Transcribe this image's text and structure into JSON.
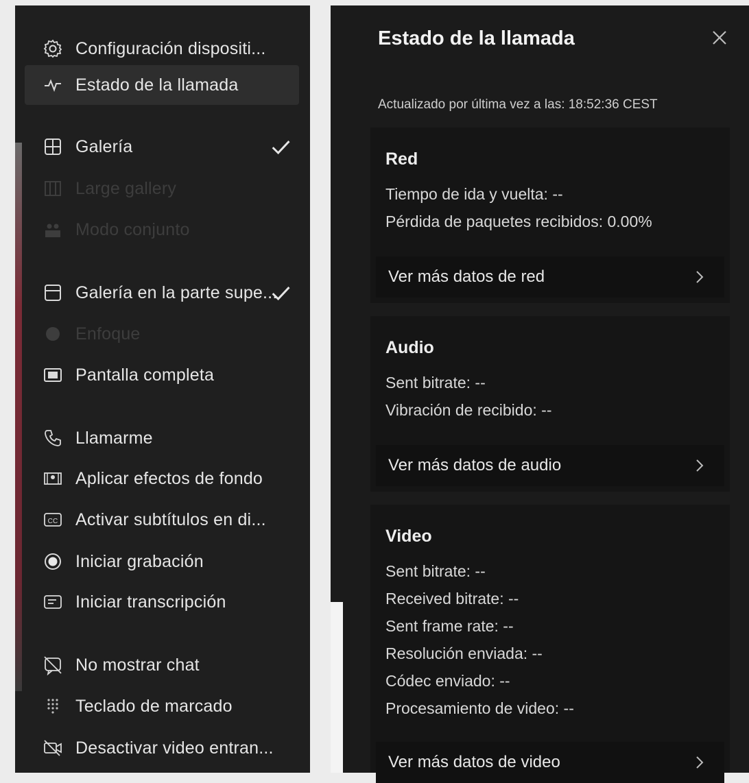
{
  "menu": {
    "items": [
      {
        "label": "Configuración dispositi...",
        "icon": "gear-icon"
      },
      {
        "label": "Estado de la llamada",
        "icon": "pulse-icon"
      },
      {
        "label": "Galería",
        "icon": "grid-icon"
      },
      {
        "label": "Large gallery",
        "icon": "large-grid-icon"
      },
      {
        "label": "Modo conjunto",
        "icon": "people-icon"
      },
      {
        "label": "Galería en la parte supe...",
        "icon": "layout-top-icon"
      },
      {
        "label": "Enfoque",
        "icon": "focus-icon"
      },
      {
        "label": "Pantalla completa",
        "icon": "fullscreen-icon"
      },
      {
        "label": "Llamarme",
        "icon": "phone-icon"
      },
      {
        "label": "Aplicar efectos de fondo",
        "icon": "background-effects-icon"
      },
      {
        "label": "Activar subtítulos en di...",
        "icon": "cc-icon"
      },
      {
        "label": "Iniciar grabación",
        "icon": "record-icon"
      },
      {
        "label": "Iniciar transcripción",
        "icon": "transcript-icon"
      },
      {
        "label": "No mostrar chat",
        "icon": "chat-off-icon"
      },
      {
        "label": "Teclado de marcado",
        "icon": "dialpad-icon"
      },
      {
        "label": "Desactivar video entran...",
        "icon": "video-off-icon"
      }
    ]
  },
  "status_panel": {
    "title": "Estado de la llamada",
    "updated": "Actualizado por última vez a las: 18:52:36 CEST",
    "red": {
      "title": "Red",
      "round_trip": "Tiempo de ida y vuelta: --",
      "packet_loss": "Pérdida de paquetes recibidos: 0.00%",
      "more": "Ver más datos de red"
    },
    "audio": {
      "title": "Audio",
      "sent_bitrate": "Sent bitrate: --",
      "jitter": "Vibración de recibido: --",
      "more": "Ver más datos de audio"
    },
    "video": {
      "title": "Video",
      "sent_bitrate": "Sent bitrate: --",
      "received_bitrate": "Received bitrate: --",
      "sent_frame_rate": "Sent frame rate: --",
      "resolution": "Resolución enviada: --",
      "codec": "Códec enviado: --",
      "processing": "Procesamiento de video: --",
      "more": "Ver más datos de video"
    }
  }
}
